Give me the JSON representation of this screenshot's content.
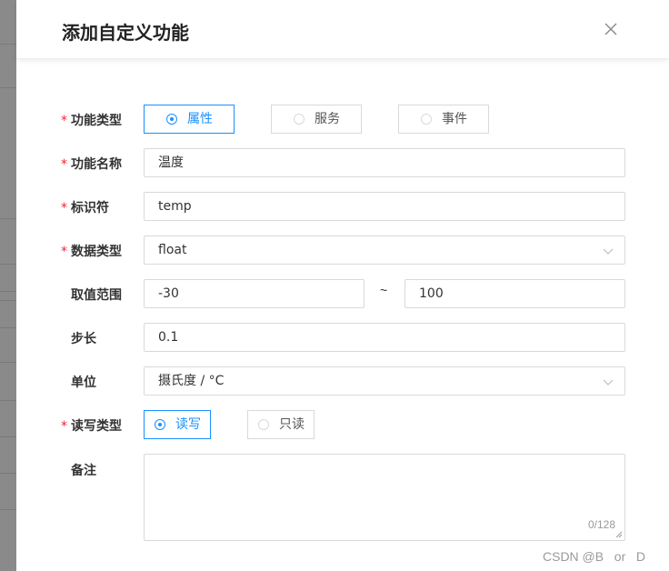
{
  "dialog": {
    "title": "添加自定义功能",
    "close_icon": "close-icon"
  },
  "form": {
    "function_type": {
      "label": "功能类型",
      "required": true,
      "options": [
        "属性",
        "服务",
        "事件"
      ],
      "selected": "属性"
    },
    "function_name": {
      "label": "功能名称",
      "required": true,
      "value": "温度"
    },
    "identifier": {
      "label": "标识符",
      "required": true,
      "value": "temp"
    },
    "data_type": {
      "label": "数据类型",
      "required": true,
      "value": "float"
    },
    "value_range": {
      "label": "取值范围",
      "min": "-30",
      "separator": "~",
      "max": "100"
    },
    "step": {
      "label": "步长",
      "value": "0.1"
    },
    "unit": {
      "label": "单位",
      "value": "摄氏度 / °C"
    },
    "rw_type": {
      "label": "读写类型",
      "required": true,
      "options": [
        "读写",
        "只读"
      ],
      "selected": "读写"
    },
    "remark": {
      "label": "备注",
      "value": "",
      "counter": "0/128"
    }
  },
  "watermark": "CSDN @B   or   D",
  "colors": {
    "accent": "#1890ff",
    "required_star": "#f5222d",
    "border": "#d9d9d9"
  }
}
